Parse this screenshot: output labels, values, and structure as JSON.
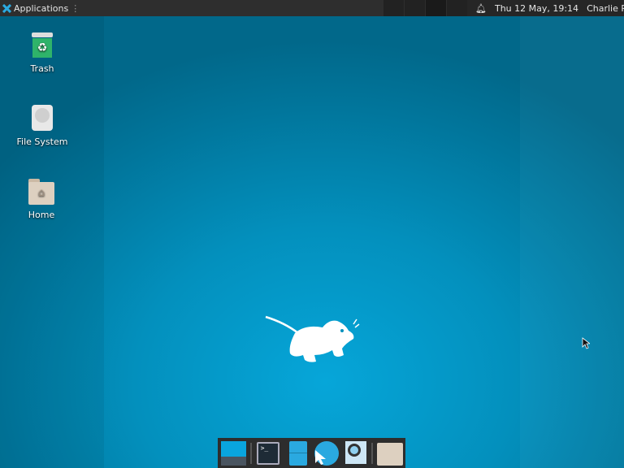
{
  "panel": {
    "applications_label": "Applications",
    "clock": "Thu 12 May, 19:14",
    "user": "Charlie Root",
    "workspaces": 4
  },
  "desktop": {
    "icons": [
      {
        "label": "Trash"
      },
      {
        "label": "File System"
      },
      {
        "label": "Home"
      }
    ]
  },
  "dock": {
    "items": [
      "show-desktop",
      "terminal",
      "file-manager",
      "web-browser",
      "app-finder",
      "home-folder"
    ]
  }
}
